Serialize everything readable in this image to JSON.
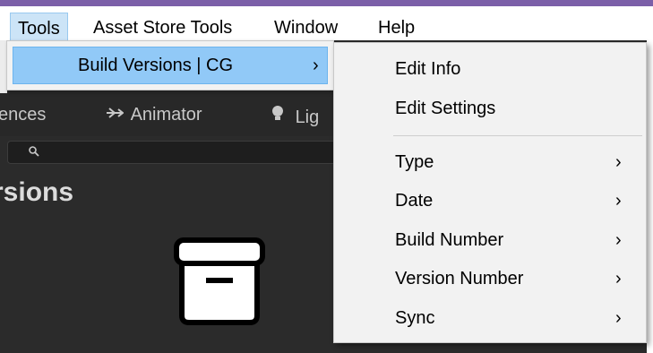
{
  "menubar": {
    "items": [
      {
        "label": "Tools",
        "active": true
      },
      {
        "label": "Asset Store Tools",
        "active": false
      },
      {
        "label": "Window",
        "active": false
      },
      {
        "label": "Help",
        "active": false
      }
    ]
  },
  "tools_menu": {
    "items": [
      {
        "label": "Build Versions | CG",
        "chevron": "›"
      }
    ]
  },
  "build_versions_menu": {
    "items": [
      {
        "label": "Edit Info"
      },
      {
        "label": "Edit Settings"
      },
      {
        "label": "Type",
        "chevron": "›"
      },
      {
        "label": "Date",
        "chevron": "›"
      },
      {
        "label": "Build Number",
        "chevron": "›"
      },
      {
        "label": "Version Number",
        "chevron": "›"
      },
      {
        "label": "Sync",
        "chevron": "›"
      }
    ]
  },
  "editor": {
    "tabs": [
      {
        "label": "ences"
      },
      {
        "label": "Animator",
        "icon": "animator-icon"
      },
      {
        "label": "Lig",
        "icon": "lightbulb-icon"
      }
    ],
    "panel_title": "rsions",
    "search": {
      "icon": "search-icon"
    },
    "empty_icon": "archive-box-icon"
  },
  "colors": {
    "accent_strip": "#7b5fa8",
    "menu_highlight": "#91c9f7",
    "editor_bg": "#2b2b2b"
  }
}
